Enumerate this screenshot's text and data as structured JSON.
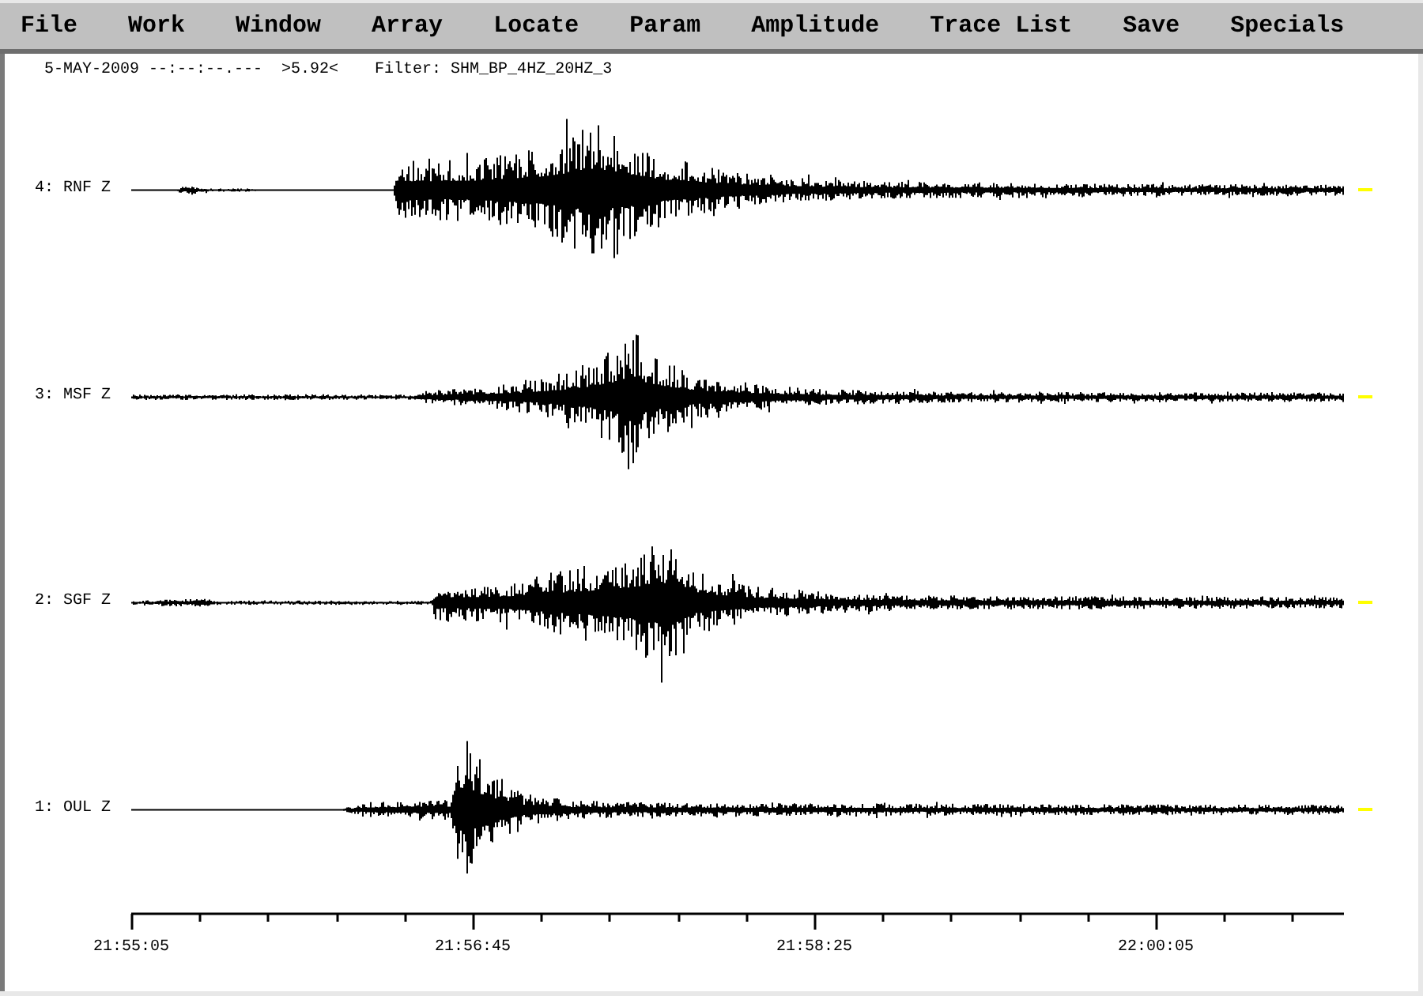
{
  "menu": [
    "File",
    "Work",
    "Window",
    "Array",
    "Locate",
    "Param",
    "Amplitude",
    "Trace List",
    "Save",
    "Specials"
  ],
  "header": {
    "datetime": "5-MAY-2009 --:--:--.---",
    "value": ">5.92<",
    "filter": "Filter: SHM_BP_4HZ_20HZ_3"
  },
  "traces": [
    {
      "label": "4: RNF Z"
    },
    {
      "label": "3: MSF Z"
    },
    {
      "label": "2: SGF Z"
    },
    {
      "label": "1: OUL Z"
    }
  ],
  "time_axis": {
    "labels": [
      "21:55:05",
      "21:56:45",
      "21:58:25",
      "22:00:05"
    ]
  }
}
